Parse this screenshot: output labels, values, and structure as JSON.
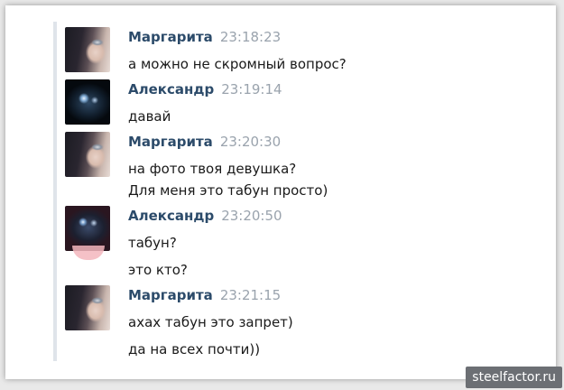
{
  "messages": [
    {
      "author": "Маргарита",
      "time": "23:18:23",
      "avatar_icon": "margarita-avatar",
      "lines": [
        "а можно не скромный вопрос?"
      ]
    },
    {
      "author": "Александр",
      "time": "23:19:14",
      "avatar_icon": "alexander-avatar",
      "lines": [
        "давай"
      ]
    },
    {
      "author": "Маргарита",
      "time": "23:20:30",
      "avatar_icon": "margarita-avatar",
      "lines": [
        "на фото твоя девушка?",
        "Для меня это табун просто)"
      ]
    },
    {
      "author": "Александр",
      "time": "23:20:50",
      "avatar_icon": "alexander-avatar",
      "lines": [
        "табун?",
        "это кто?"
      ]
    },
    {
      "author": "Маргарита",
      "time": "23:21:15",
      "avatar_icon": "margarita-avatar",
      "lines": [
        "ахах табун это запрет)",
        "да на всех почти))"
      ]
    }
  ],
  "watermark": "steelfactor.ru",
  "colors": {
    "author_name": "#2c4b6a",
    "timestamp": "#9aa3ad",
    "message_text": "#1a1a1a",
    "watermark_bg": "#6c6f74"
  }
}
